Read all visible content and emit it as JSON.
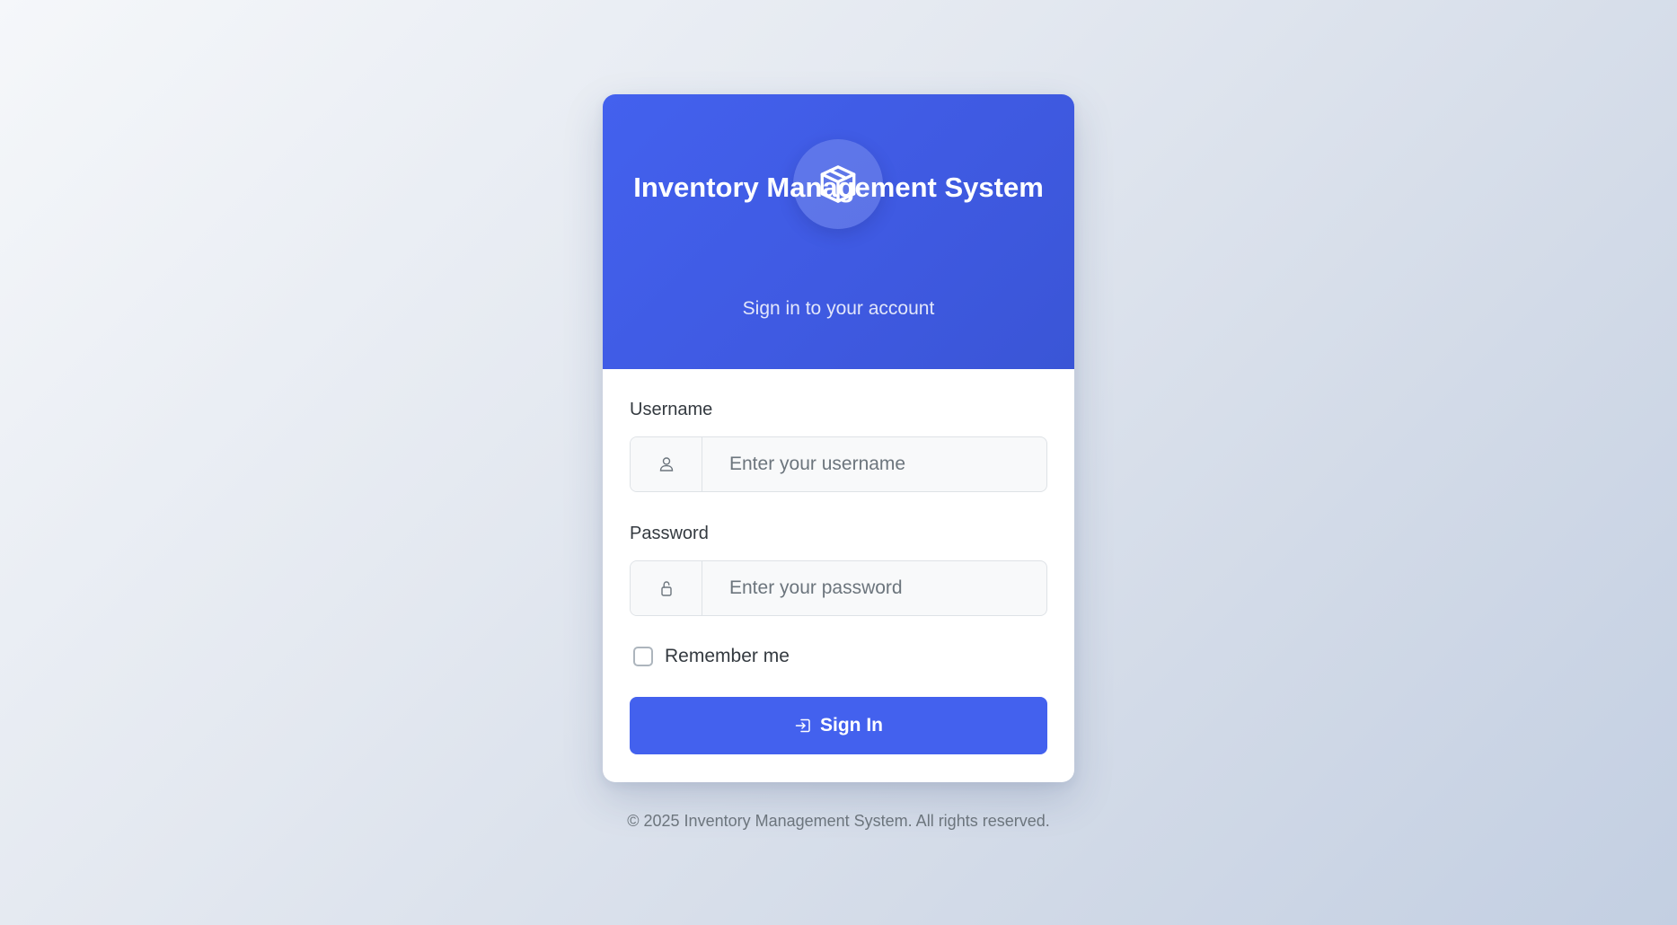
{
  "header": {
    "logo_icon": "box-icon",
    "title": "Inventory Management System",
    "subtitle": "Sign in to your account"
  },
  "form": {
    "username": {
      "label": "Username",
      "icon": "user-icon",
      "value": "",
      "placeholder": "Enter your username"
    },
    "password": {
      "label": "Password",
      "icon": "lock-icon",
      "value": "",
      "placeholder": "Enter your password"
    },
    "remember": {
      "label": "Remember me",
      "checked": false
    },
    "submit": {
      "icon": "sign-in-icon",
      "label": "Sign In"
    }
  },
  "footer": {
    "text": "© 2025 Inventory Management System. All rights reserved."
  },
  "colors": {
    "primary": "#4361ee",
    "header_gradient_end": "#3a55d6",
    "background_start": "#f5f7fa",
    "background_end": "#c3cfe2",
    "label_text": "#343a40",
    "muted_text": "#6c757d",
    "input_background": "#f8f9fa",
    "input_border": "#dee2e6"
  }
}
